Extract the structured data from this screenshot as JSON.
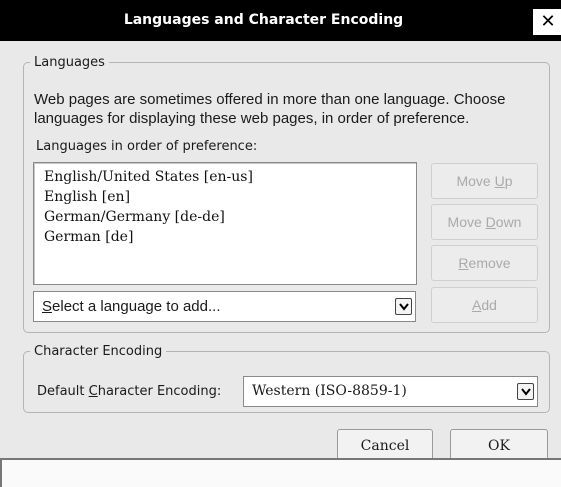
{
  "window": {
    "title": "Languages and Character Encoding",
    "close_glyph": "✕"
  },
  "languages_group": {
    "legend": "Languages",
    "description": "Web pages are sometimes offered in more than one language. Choose languages for displaying these web pages, in order of preference.",
    "list_label": "Languages in order of preference:",
    "items": [
      "English/United States  [en-us]",
      "English  [en]",
      "German/Germany  [de-de]",
      "German  [de]"
    ],
    "buttons": {
      "move_up": {
        "pre": "Move ",
        "accel": "U",
        "post": "p"
      },
      "move_down": {
        "pre": "Move ",
        "accel": "D",
        "post": "own"
      },
      "remove": {
        "pre": "",
        "accel": "R",
        "post": "emove"
      },
      "add": {
        "pre": "",
        "accel": "A",
        "post": "dd"
      }
    },
    "add_select": {
      "pre": "",
      "accel": "S",
      "post": "elect a language to add..."
    }
  },
  "encoding_group": {
    "legend": "Character Encoding",
    "default_label": {
      "pre": "Default ",
      "accel": "C",
      "post": "haracter Encoding:"
    },
    "selected": "Western (ISO-8859-1)"
  },
  "dialog_buttons": {
    "cancel": "Cancel",
    "ok": "OK"
  },
  "icons": {
    "close": "close-icon",
    "dropdown": "chevron-down-icon"
  },
  "colors": {
    "titlebar": "#000000",
    "dialog_bg": "#e9e9e9",
    "disabled_text": "#aaaaaa"
  }
}
